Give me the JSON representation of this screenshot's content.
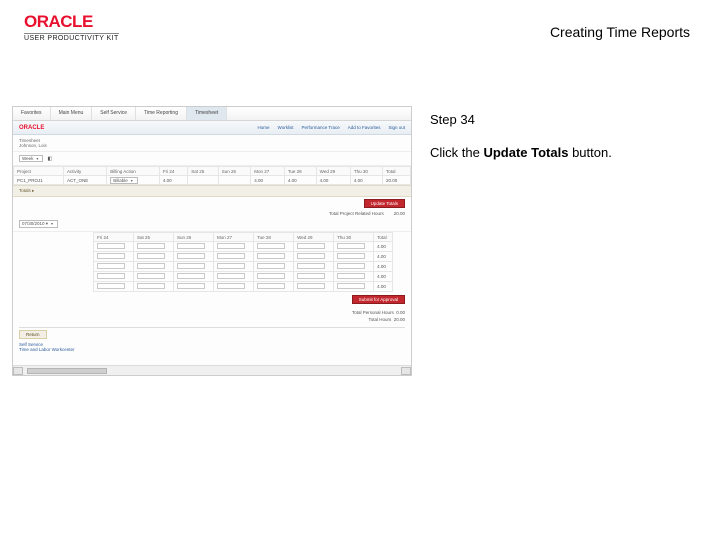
{
  "header": {
    "brand_top": "ORACLE",
    "brand_sub": "USER PRODUCTIVITY KIT",
    "page_title": "Creating Time Reports"
  },
  "instructions": {
    "step_label": "Step 34",
    "body_prefix": "Click the ",
    "body_bold": "Update Totals",
    "body_suffix": " button."
  },
  "app": {
    "tabs": [
      "Favorites",
      "Main Menu",
      "Self Service",
      "Time Reporting",
      "Timesheet"
    ],
    "brand": "ORACLE",
    "nav_links": [
      "Home",
      "Worklist",
      "Performance Trace",
      "Add to Favorites",
      "Sign out"
    ],
    "crumb_line1": "Timesheet",
    "crumb_line2": "Johnson, Lois",
    "panel_select_value": "Week",
    "panel_icon": "◧",
    "table1": {
      "headers": [
        "Project",
        "Activity",
        "Billing Action",
        "Fri 24",
        "Sat 25",
        "Sun 26",
        "Mon 27",
        "Tue 28",
        "Wed 29",
        "Thu 30",
        "Total"
      ],
      "row": {
        "project": "PC1_PROJ1",
        "activity": "ACT_ONE",
        "billing": "Billable",
        "cells": [
          "4.00",
          "",
          "",
          "4.00",
          "4.00",
          "4.00",
          "4.00"
        ],
        "total": "20.00"
      }
    },
    "section_tab": "Totals ▸",
    "update_btn": "Update Totals",
    "totals_line_label": "Total Project Related Hours",
    "totals_line_value": "20.00",
    "section2_label": "07/30/2010 ▾",
    "table2": {
      "headers": [
        "Fri 24",
        "Sat 25",
        "Sun 26",
        "Mon 27",
        "Tue 28",
        "Wed 29",
        "Thu 30",
        "Total"
      ],
      "rows": [
        [
          "",
          "",
          "",
          "",
          "",
          "",
          "",
          "4.00"
        ],
        [
          "",
          "",
          "",
          "",
          "",
          "",
          "",
          "4.00"
        ],
        [
          "",
          "",
          "",
          "",
          "",
          "",
          "",
          "4.00"
        ],
        [
          "",
          "",
          "",
          "",
          "",
          "",
          "",
          "4.00"
        ],
        [
          "",
          "",
          "",
          "",
          "",
          "",
          "",
          "4.00"
        ]
      ]
    },
    "submit_btn": "Submit for Approval",
    "summary": [
      {
        "label": "Total Personal Hours",
        "value": "0.00"
      },
      {
        "label": "Total Hours",
        "value": "20.00"
      }
    ],
    "mini_btn": "Return",
    "footer_links": [
      "Self Service",
      "Time and Labor Workcenter"
    ]
  }
}
